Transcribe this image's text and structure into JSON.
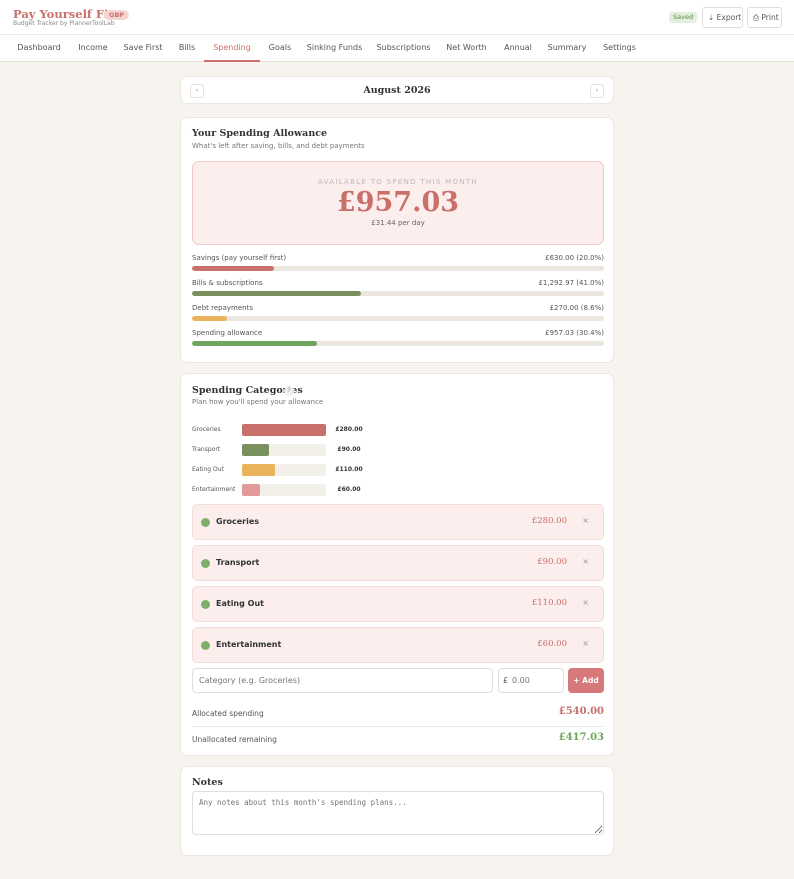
{
  "header": {
    "brand": "Pay Yourself First",
    "currency_badge": "GBP",
    "subtitle": "Budget Tracker by PlannerToolLab",
    "saved_status": "Saved",
    "export_label": "⇣ Export",
    "print_label": "⎙ Print"
  },
  "nav": {
    "items": [
      "Dashboard",
      "Income",
      "Save First",
      "Bills",
      "Spending",
      "Goals",
      "Sinking Funds",
      "Subscriptions",
      "Net Worth",
      "Annual",
      "Summary",
      "Settings"
    ],
    "active": "Spending"
  },
  "month": {
    "title": "August 2026",
    "prev_icon": "‹",
    "next_icon": "›"
  },
  "allowance": {
    "title": "Your Spending Allowance",
    "subtitle": "What's left after saving, bills, and debt payments",
    "hero_label": "AVAILABLE TO SPEND THIS MONTH",
    "hero_amount": "£957.03",
    "hero_daily": "£31.44 per day",
    "rows": [
      {
        "label": "Savings (pay yourself first)",
        "value": "£630.00 (20.0%)",
        "percent": 20.0,
        "color": "#c9706a"
      },
      {
        "label": "Bills & subscriptions",
        "value": "£1,292.97 (41.0%)",
        "percent": 41.0,
        "color": "#7a8f5e"
      },
      {
        "label": "Debt repayments",
        "value": "£270.00 (8.6%)",
        "percent": 8.6,
        "color": "#e8b35a"
      },
      {
        "label": "Spending allowance",
        "value": "£957.03 (30.4%)",
        "percent": 30.4,
        "color": "#6fa55e"
      }
    ]
  },
  "categories": {
    "title": "Spending Categories",
    "help_icon": "?",
    "subtitle": "Plan how you'll spend your allowance",
    "bars": [
      {
        "label": "Groceries",
        "value": "£280.00",
        "amount": 280,
        "color": "#c9706a"
      },
      {
        "label": "Transport",
        "value": "£90.00",
        "amount": 90,
        "color": "#7a8f5e"
      },
      {
        "label": "Eating Out",
        "value": "£110.00",
        "amount": 110,
        "color": "#e8b35a"
      },
      {
        "label": "Entertainment",
        "value": "£60.00",
        "amount": 60,
        "color": "#e39b9a"
      }
    ],
    "bar_max": 280,
    "items": [
      {
        "name": "Groceries",
        "amount": "£280.00"
      },
      {
        "name": "Transport",
        "amount": "£90.00"
      },
      {
        "name": "Eating Out",
        "amount": "£110.00"
      },
      {
        "name": "Entertainment",
        "amount": "£60.00"
      }
    ],
    "remove_icon": "×",
    "category_placeholder": "Category (e.g. Groceries)",
    "currency_symbol": "£",
    "amount_placeholder": "0.00",
    "add_label": "+ Add",
    "allocated_label": "Allocated spending",
    "allocated_value": "£540.00",
    "allocated_color": "#c9706a",
    "unallocated_label": "Unallocated remaining",
    "unallocated_value": "£417.03",
    "unallocated_color": "#6fa55e"
  },
  "notes": {
    "title": "Notes",
    "placeholder": "Any notes about this month's spending plans..."
  }
}
